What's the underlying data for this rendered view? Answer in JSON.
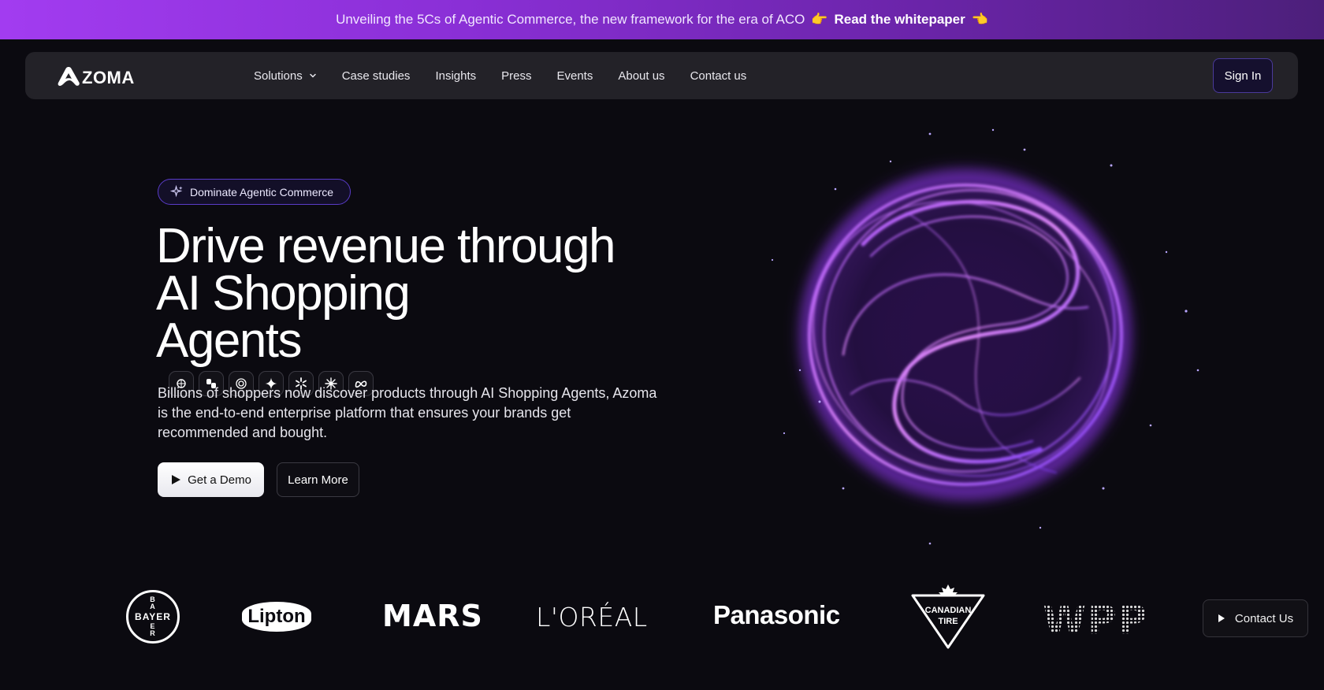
{
  "announcement": {
    "text": "Unveiling the 5Cs of Agentic Commerce, the new framework for the era of ACO",
    "emoji_left": "👉",
    "link_label": "Read the whitepaper",
    "emoji_right": "👈"
  },
  "nav": {
    "logo_text": "ZOMA",
    "links": [
      {
        "label": "Solutions",
        "has_dropdown": true
      },
      {
        "label": "Case studies"
      },
      {
        "label": "Insights"
      },
      {
        "label": "Press"
      },
      {
        "label": "Events"
      },
      {
        "label": "About us"
      },
      {
        "label": "Contact us"
      }
    ],
    "signin_label": "Sign In"
  },
  "hero": {
    "pill_label": "Dominate Agentic Commerce",
    "headline_line1": "Drive revenue through",
    "headline_line2": "AI Shopping",
    "headline_line3": "Agents",
    "agent_icons": [
      "perplexity-icon",
      "copilot-icon",
      "chatgpt-icon",
      "gemini-icon",
      "walmart-spark-icon",
      "claude-icon",
      "meta-icon"
    ],
    "subtext": "Billions of shoppers now discover products through AI Shopping Agents, Azoma is the end-to-end enterprise platform that ensures your brands get recommended and bought.",
    "demo_label": "Get a Demo",
    "learn_label": "Learn More"
  },
  "logos": {
    "bayer": "BAYER",
    "bayer_vertical": [
      "B",
      "A",
      "Y",
      "E",
      "R"
    ],
    "lipton": "Lipton",
    "mars": "MARS",
    "loreal": "L'ORÉAL",
    "panasonic": "Panasonic",
    "canadian_tire_1": "CANADIAN",
    "canadian_tire_2": "TIRE",
    "wpp": "WPP"
  },
  "contact_button_label": "Contact Us",
  "colors": {
    "background": "#0b0a10",
    "announce_start": "#a23cf0",
    "accent_purple": "#8b3cf7",
    "nav_bg": "#232228"
  }
}
